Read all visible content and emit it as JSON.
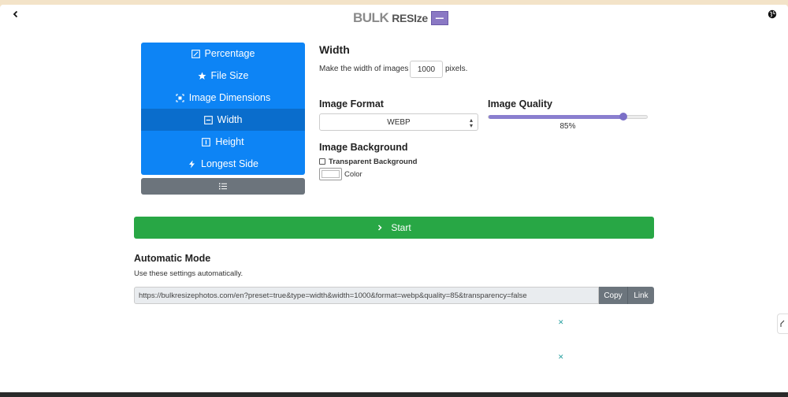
{
  "header": {
    "logo_word1": "BULK",
    "logo_word2": "RESIze",
    "back_icon": "chevron-left-icon",
    "globe_icon": "globe-icon"
  },
  "menu": {
    "items": [
      {
        "label": "Percentage",
        "icon": "edit-square-icon",
        "active": false
      },
      {
        "label": "File Size",
        "icon": "star-icon",
        "active": false
      },
      {
        "label": "Image Dimensions",
        "icon": "dimensions-icon",
        "active": false
      },
      {
        "label": "Width",
        "icon": "minus-square-icon",
        "active": true
      },
      {
        "label": "Height",
        "icon": "height-square-icon",
        "active": false
      },
      {
        "label": "Longest Side",
        "icon": "lightning-icon",
        "active": false
      }
    ],
    "toggle_icon": "list-icon"
  },
  "width": {
    "title": "Width",
    "desc_before": "Make the width of images",
    "value": "1000",
    "desc_after": "pixels."
  },
  "format": {
    "title": "Image Format",
    "selected": "WEBP"
  },
  "quality": {
    "title": "Image Quality",
    "value": 85,
    "value_label": "85%"
  },
  "background": {
    "title": "Image Background",
    "transparent_label": "Transparent Background",
    "transparent_checked": false,
    "color_label": "Color",
    "color_value": "#ffffff"
  },
  "start": {
    "label": "Start",
    "icon": "chevron-right-icon"
  },
  "automatic": {
    "title": "Automatic Mode",
    "desc": "Use these settings automatically.",
    "url": "https://bulkresizephotos.com/en?preset=true&type=width&width=1000&format=webp&quality=85&transparency=false",
    "copy_label": "Copy",
    "link_label": "Link"
  },
  "ads": {
    "close_glyph": "✕"
  },
  "colors": {
    "menu_bg": "#0d84f5",
    "menu_active": "#0a6dcc",
    "start_bg": "#28a745",
    "slider": "#8a7fcf",
    "button_gray": "#6c757d"
  }
}
